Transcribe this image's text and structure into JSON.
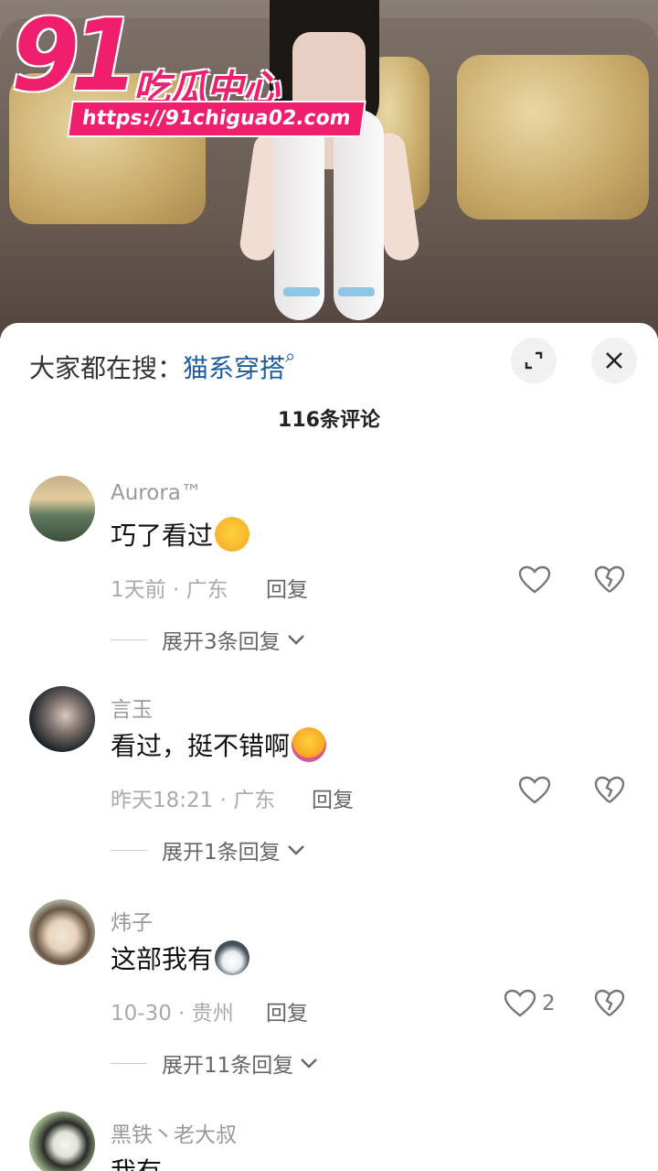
{
  "watermark": {
    "logo_number": "91",
    "logo_text": "吃瓜中心",
    "url": "https://91chigua02.com"
  },
  "search_bar": {
    "prefix": "大家都在搜：",
    "keyword": "猫系穿搭"
  },
  "comments_header": {
    "count_label": "116条评论"
  },
  "comments": [
    {
      "username": "Aurora™",
      "text": "巧了看过",
      "emoji": "blushing-face",
      "time_location": "1天前 · 广东",
      "reply_label": "回复",
      "likes": "",
      "expand_label": "展开3条回复"
    },
    {
      "username": "言玉",
      "text": "看过，挺不错啊",
      "emoji": "hugging-face",
      "time_location": "昨天18:21 · 广东",
      "reply_label": "回复",
      "likes": "",
      "expand_label": "展开1条回复"
    },
    {
      "username": "炜子",
      "text": "这部我有",
      "emoji": "husky-face",
      "time_location": "10-30 · 贵州",
      "reply_label": "回复",
      "likes": "2",
      "expand_label": "展开11条回复"
    },
    {
      "username": "黑铁丶老大叔",
      "text": "我有",
      "emoji": "",
      "time_location": "",
      "reply_label": "",
      "likes": "",
      "expand_label": ""
    }
  ],
  "colors": {
    "brand_pink": "#ef1f6e",
    "keyword_blue": "#1f5c9e"
  }
}
